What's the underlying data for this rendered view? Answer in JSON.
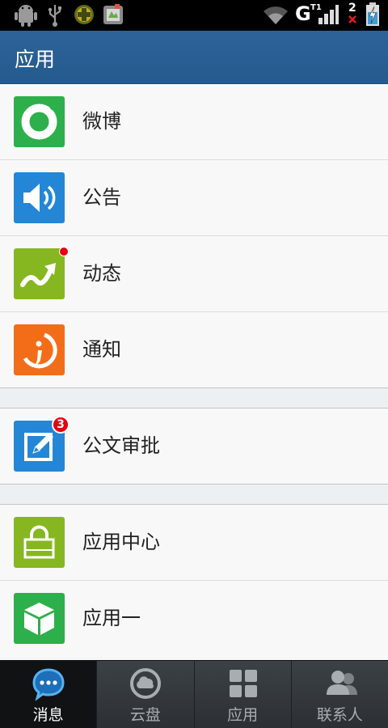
{
  "status_bar": {
    "network": "G",
    "signal_suffix": "T1",
    "sim_count": "2",
    "icons": [
      "android-debug-icon",
      "usb-icon",
      "game-icon",
      "app-notification-icon",
      "wifi-icon",
      "signal-icon",
      "sim-blocked-icon",
      "battery-charging-icon"
    ]
  },
  "header": {
    "title": "应用"
  },
  "apps": [
    {
      "label": "微博",
      "icon": "weibo-icon",
      "color": "#2db04b"
    },
    {
      "label": "公告",
      "icon": "megaphone-icon",
      "color": "#2386d6"
    },
    {
      "label": "动态",
      "icon": "trend-arrow-icon",
      "color": "#86b720",
      "badge_dot": true
    },
    {
      "label": "通知",
      "icon": "notice-icon",
      "color": "#f36d19"
    },
    {
      "label": "公文审批",
      "icon": "edit-document-icon",
      "color": "#2386d6",
      "badge_count": "3"
    },
    {
      "label": "应用中心",
      "icon": "app-store-bag-icon",
      "color": "#86b720"
    },
    {
      "label": "应用一",
      "icon": "cube-icon",
      "color": "#2db04b"
    }
  ],
  "bottom_nav": [
    {
      "label": "消息",
      "icon": "chat-bubble-icon",
      "active": true
    },
    {
      "label": "云盘",
      "icon": "cloud-disk-icon",
      "active": false
    },
    {
      "label": "应用",
      "icon": "apps-grid-icon",
      "active": false
    },
    {
      "label": "联系人",
      "icon": "contacts-icon",
      "active": false
    }
  ],
  "colors": {
    "header_bg": "#2b6198",
    "accent_blue": "#2386d6",
    "badge_red": "#e60012",
    "nav_bg": "#2f3337"
  }
}
